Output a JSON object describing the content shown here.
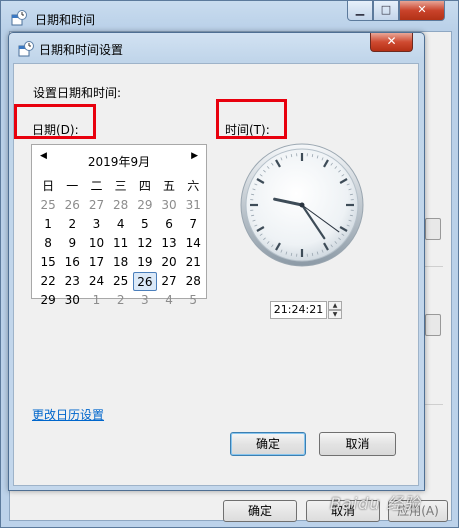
{
  "outer_window": {
    "title": "日期和时间",
    "ok": "确定",
    "cancel": "取消",
    "apply": "应用(A)"
  },
  "dialog": {
    "title": "日期和时间设置",
    "heading": "设置日期和时间:",
    "date_label": "日期(D):",
    "time_label": "时间(T):",
    "change_calendar_link": "更改日历设置",
    "ok": "确定",
    "cancel": "取消"
  },
  "calendar": {
    "month_label": "2019年9月",
    "weekdays": [
      "日",
      "一",
      "二",
      "三",
      "四",
      "五",
      "六"
    ],
    "weeks": [
      [
        {
          "d": "25",
          "o": true
        },
        {
          "d": "26",
          "o": true
        },
        {
          "d": "27",
          "o": true
        },
        {
          "d": "28",
          "o": true
        },
        {
          "d": "29",
          "o": true
        },
        {
          "d": "30",
          "o": true
        },
        {
          "d": "31",
          "o": true
        }
      ],
      [
        {
          "d": "1"
        },
        {
          "d": "2"
        },
        {
          "d": "3"
        },
        {
          "d": "4"
        },
        {
          "d": "5"
        },
        {
          "d": "6"
        },
        {
          "d": "7"
        }
      ],
      [
        {
          "d": "8"
        },
        {
          "d": "9"
        },
        {
          "d": "10"
        },
        {
          "d": "11"
        },
        {
          "d": "12"
        },
        {
          "d": "13"
        },
        {
          "d": "14"
        }
      ],
      [
        {
          "d": "15"
        },
        {
          "d": "16"
        },
        {
          "d": "17"
        },
        {
          "d": "18"
        },
        {
          "d": "19"
        },
        {
          "d": "20"
        },
        {
          "d": "21"
        }
      ],
      [
        {
          "d": "22"
        },
        {
          "d": "23"
        },
        {
          "d": "24"
        },
        {
          "d": "25"
        },
        {
          "d": "26",
          "sel": true
        },
        {
          "d": "27"
        },
        {
          "d": "28"
        }
      ],
      [
        {
          "d": "29"
        },
        {
          "d": "30"
        },
        {
          "d": "1",
          "o": true
        },
        {
          "d": "2",
          "o": true
        },
        {
          "d": "3",
          "o": true
        },
        {
          "d": "4",
          "o": true
        },
        {
          "d": "5",
          "o": true
        }
      ]
    ]
  },
  "time": {
    "value": "21:24:21",
    "hour": 21,
    "minute": 24,
    "second": 21
  },
  "watermark": "Baidu 经验",
  "colors": {
    "highlight_box": "#e8000e",
    "link": "#0066cc"
  }
}
